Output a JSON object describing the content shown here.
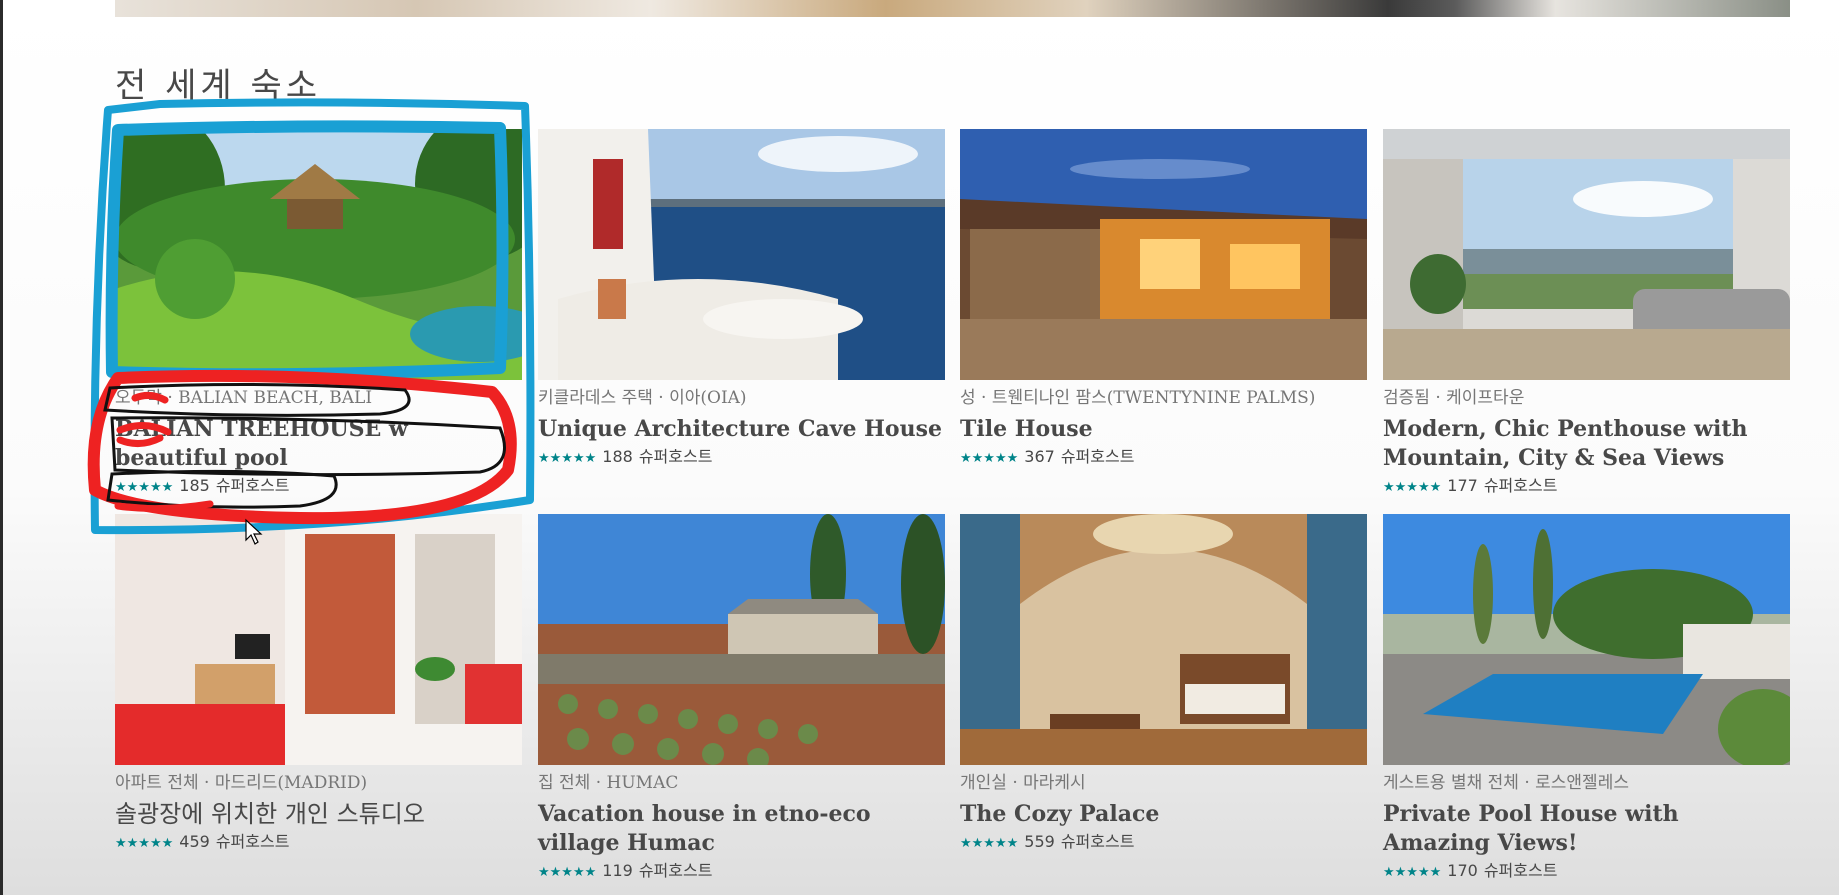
{
  "section_title": "전 세계 숙소",
  "listings": [
    {
      "type": "오두막 · BALIAN BEACH, BALI",
      "name": "BALIAN TREEHOUSE w beautiful pool",
      "stars": "★★★★★",
      "reviews": "185",
      "badge": "슈퍼호스트"
    },
    {
      "type": "키클라데스 주택 · 이아(OIA)",
      "name": "Unique Architecture Cave House",
      "stars": "★★★★★",
      "reviews": "188",
      "badge": "슈퍼호스트"
    },
    {
      "type": "성 · 트웬티나인 팜스(TWENTYNINE PALMS)",
      "name": "Tile House",
      "stars": "★★★★★",
      "reviews": "367",
      "badge": "슈퍼호스트"
    },
    {
      "type": "검증됨 · 케이프타운",
      "name": "Modern, Chic Penthouse with Mountain, City & Sea Views",
      "stars": "★★★★★",
      "reviews": "177",
      "badge": "슈퍼호스트"
    },
    {
      "type": "아파트 전체 · 마드리드(MADRID)",
      "name": "솔광장에 위치한 개인 스튜디오",
      "stars": "★★★★★",
      "reviews": "459",
      "badge": "슈퍼호스트"
    },
    {
      "type": "집 전체 · HUMAC",
      "name": "Vacation house in etno-eco village Humac",
      "stars": "★★★★★",
      "reviews": "119",
      "badge": "슈퍼호스트"
    },
    {
      "type": "개인실 · 마라케시",
      "name": "The Cozy Palace",
      "stars": "★★★★★",
      "reviews": "559",
      "badge": "슈퍼호스트"
    },
    {
      "type": "게스트용 별채 전체 · 로스앤젤레스",
      "name": "Private Pool House with Amazing Views!",
      "stars": "★★★★★",
      "reviews": "170",
      "badge": "슈퍼호스트"
    }
  ],
  "colors": {
    "star": "#008489",
    "text": "#484848",
    "meta": "#767676",
    "annotation_blue": "#1aa0d4",
    "annotation_red": "#ee2222"
  }
}
